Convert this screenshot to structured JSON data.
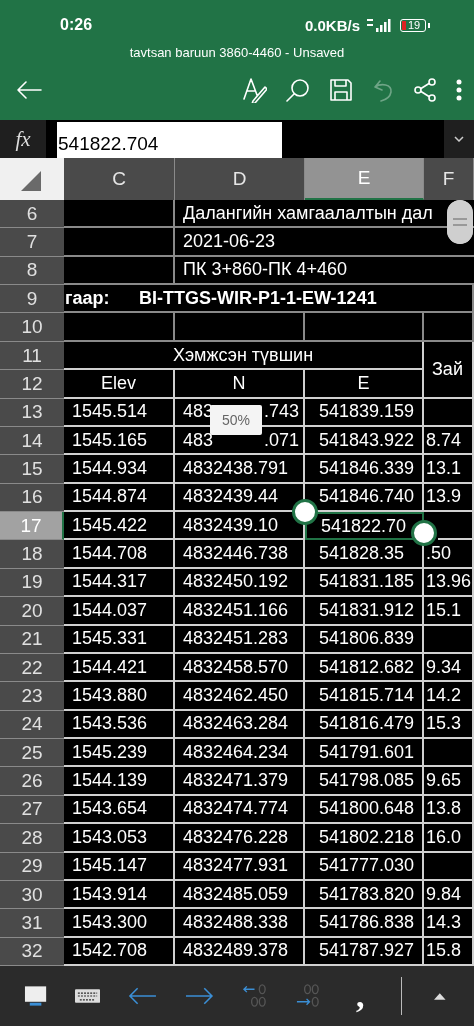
{
  "status_bar": {
    "time": "0:26",
    "speed": "0.0KB/s",
    "battery": "19"
  },
  "window": {
    "title": "tavtsan baruun 3860-4460 - Unsaved"
  },
  "toolbar": {
    "undo_disabled": true
  },
  "formula_bar": {
    "label": "fx",
    "value": "541822.704"
  },
  "zoom_tooltip": "50%",
  "columns": [
    {
      "label": "C",
      "selected": false
    },
    {
      "label": "D",
      "selected": false
    },
    {
      "label": "E",
      "selected": true
    },
    {
      "label": "F",
      "selected": false
    }
  ],
  "rows": [
    {
      "number": "6",
      "selected": false,
      "kind": "title",
      "text": "Далангийн  хамгаалалтын дал"
    },
    {
      "number": "7",
      "selected": false,
      "kind": "title",
      "text": "2021-06-23"
    },
    {
      "number": "8",
      "selected": false,
      "kind": "title",
      "text": "ПК 3+860-ПК 4+460"
    },
    {
      "number": "9",
      "selected": false,
      "kind": "label",
      "label": "гаар:",
      "text": "BI-TTGS-WIR-P1-1-EW-1241"
    },
    {
      "number": "10",
      "selected": false,
      "kind": "blank"
    },
    {
      "number": "11",
      "selected": false,
      "kind": "group",
      "text": "Хэмжсэн түвшин",
      "side": "Зай"
    },
    {
      "number": "12",
      "selected": false,
      "kind": "heads",
      "cells": [
        "Elev",
        "N",
        "E"
      ]
    },
    {
      "number": "13",
      "selected": false,
      "kind": "data",
      "cells": [
        "1545.514",
        "483",
        "541839.159"
      ],
      "n_end": ".743"
    },
    {
      "number": "14",
      "selected": false,
      "kind": "data",
      "cells": [
        "1545.165",
        "483",
        "541843.922",
        "8.74"
      ],
      "n_end": ".071"
    },
    {
      "number": "15",
      "selected": false,
      "kind": "data",
      "cells": [
        "1544.934",
        "4832438.791",
        "541846.339",
        "13.1"
      ]
    },
    {
      "number": "16",
      "selected": false,
      "kind": "data",
      "cells": [
        "1544.874",
        "4832439.44",
        "541846.740",
        "13.9"
      ]
    },
    {
      "number": "17",
      "selected": true,
      "kind": "data",
      "cells": [
        "1545.422",
        "4832439.10",
        "541822.70"
      ]
    },
    {
      "number": "18",
      "selected": false,
      "kind": "data",
      "cells": [
        "1544.708",
        "4832446.738",
        "541828.35",
        ".50"
      ]
    },
    {
      "number": "19",
      "selected": false,
      "kind": "data",
      "cells": [
        "1544.317",
        "4832450.192",
        "541831.185",
        "13.96"
      ]
    },
    {
      "number": "20",
      "selected": false,
      "kind": "data",
      "cells": [
        "1544.037",
        "4832451.166",
        "541831.912",
        "15.1"
      ]
    },
    {
      "number": "21",
      "selected": false,
      "kind": "data",
      "cells": [
        "1545.331",
        "4832451.283",
        "541806.839"
      ]
    },
    {
      "number": "22",
      "selected": false,
      "kind": "data",
      "cells": [
        "1544.421",
        "4832458.570",
        "541812.682",
        "9.34"
      ]
    },
    {
      "number": "23",
      "selected": false,
      "kind": "data",
      "cells": [
        "1543.880",
        "4832462.450",
        "541815.714",
        "14.2"
      ]
    },
    {
      "number": "24",
      "selected": false,
      "kind": "data",
      "cells": [
        "1543.536",
        "4832463.284",
        "541816.479",
        "15.3"
      ]
    },
    {
      "number": "25",
      "selected": false,
      "kind": "data",
      "cells": [
        "1545.239",
        "4832464.234",
        "541791.601"
      ]
    },
    {
      "number": "26",
      "selected": false,
      "kind": "data",
      "cells": [
        "1544.139",
        "4832471.379",
        "541798.085",
        "9.65"
      ]
    },
    {
      "number": "27",
      "selected": false,
      "kind": "data",
      "cells": [
        "1543.654",
        "4832474.774",
        "541800.648",
        "13.8"
      ]
    },
    {
      "number": "28",
      "selected": false,
      "kind": "data",
      "cells": [
        "1543.053",
        "4832476.228",
        "541802.218",
        "16.0"
      ]
    },
    {
      "number": "29",
      "selected": false,
      "kind": "data",
      "cells": [
        "1545.147",
        "4832477.931",
        "541777.030"
      ]
    },
    {
      "number": "30",
      "selected": false,
      "kind": "data",
      "cells": [
        "1543.914",
        "4832485.059",
        "541783.820",
        "9.84"
      ]
    },
    {
      "number": "31",
      "selected": false,
      "kind": "data",
      "cells": [
        "1543.300",
        "4832488.338",
        "541786.838",
        "14.3"
      ]
    },
    {
      "number": "32",
      "selected": false,
      "kind": "data",
      "cells": [
        "1542.708",
        "4832489.378",
        "541787.927",
        "15.8"
      ]
    }
  ],
  "key_bar": {
    "comma": ","
  }
}
